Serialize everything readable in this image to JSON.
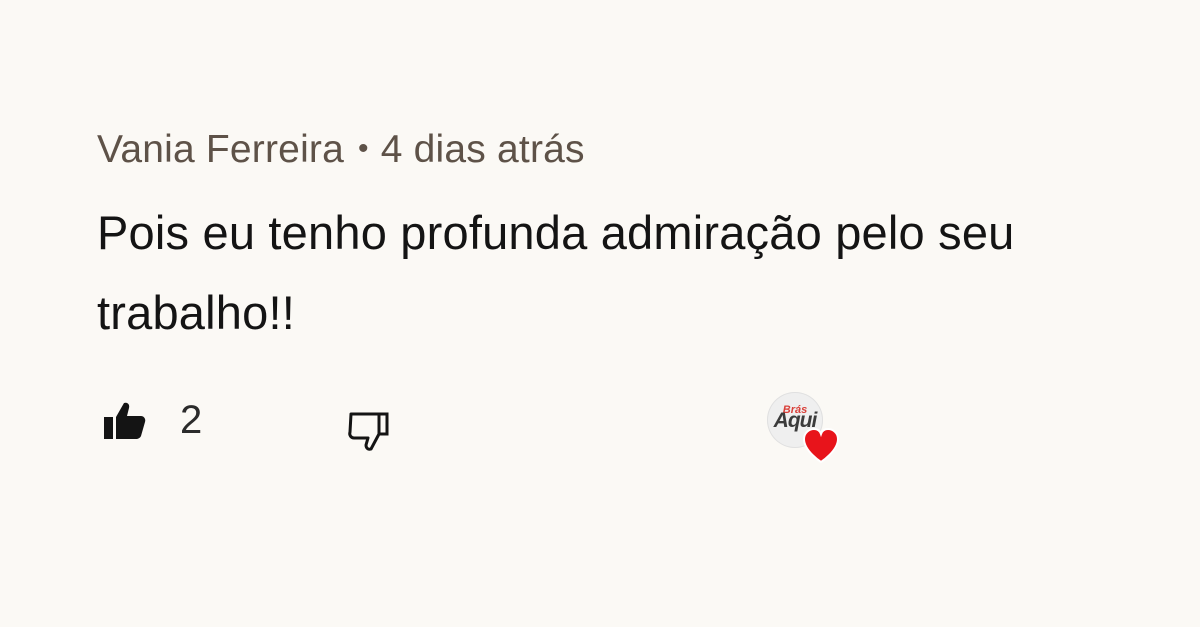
{
  "comment": {
    "author": "Vania Ferreira",
    "separator": "•",
    "timestamp": "4 dias atrás",
    "text": "Pois eu tenho profunda admiração pelo seu trabalho!!",
    "like_count": "2",
    "icons": {
      "like": "thumbs-up-icon",
      "dislike": "thumbs-down-icon",
      "creator_heart": "heart-icon"
    },
    "creator_avatar": {
      "logo_small": "Brás",
      "logo_main": "Aqui"
    },
    "colors": {
      "background": "#fbf9f5",
      "author_text": "#5e5248",
      "body_text": "#141414",
      "heart": "#e8141b"
    }
  }
}
